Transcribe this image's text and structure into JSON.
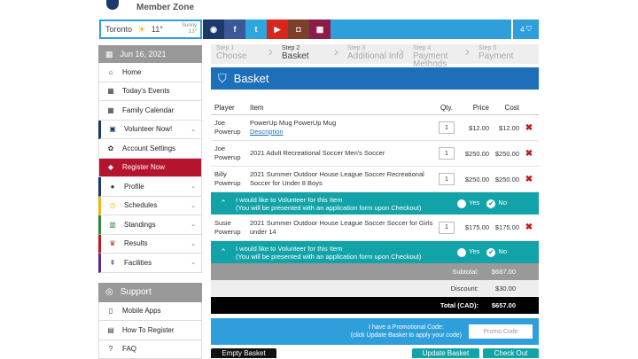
{
  "header": {
    "zone_title": "Member Zone",
    "cart_count": "4"
  },
  "weather": {
    "city": "Toronto",
    "temp": "11°",
    "condition": "Sunny",
    "condition_temp": "13°"
  },
  "sidebar": {
    "date": "Jun 16, 2021",
    "items": [
      {
        "label": "Home",
        "icon": "home-icon",
        "glyph": "⌂"
      },
      {
        "label": "Today's Events",
        "icon": "calendar-icon",
        "glyph": "▦"
      },
      {
        "label": "Family Calendar",
        "icon": "calendar-icon",
        "glyph": "▦"
      },
      {
        "label": "Volunteer Now!",
        "icon": "volunteer-icon",
        "glyph": "▣",
        "color": "#1b3a6b"
      },
      {
        "label": "Account Settings",
        "icon": "gear-icon",
        "glyph": "✿"
      },
      {
        "label": "Register Now",
        "icon": "tag-icon",
        "glyph": "◆"
      },
      {
        "label": "Profile",
        "icon": "user-icon",
        "glyph": "●",
        "color": "#1b3a6b"
      },
      {
        "label": "Schedules",
        "icon": "clock-icon",
        "glyph": "◷",
        "color": "#f3b21b"
      },
      {
        "label": "Standings",
        "icon": "bar-chart-icon",
        "glyph": "▥",
        "color": "#2e8b3a"
      },
      {
        "label": "Results",
        "icon": "trophy-icon",
        "glyph": "♛",
        "color": "#c01a1a"
      },
      {
        "label": "Facilities",
        "icon": "facilities-icon",
        "glyph": "⇞",
        "color": "#5a2d8c"
      }
    ],
    "support_title": "Support",
    "support_items": [
      {
        "label": "Mobile Apps",
        "icon": "mobile-icon",
        "glyph": "▯"
      },
      {
        "label": "How To Register",
        "icon": "document-icon",
        "glyph": "▤"
      },
      {
        "label": "FAQ",
        "icon": "question-icon",
        "glyph": "?"
      }
    ]
  },
  "steps": [
    {
      "num": "Step 1",
      "label": "Choose"
    },
    {
      "num": "Step 2",
      "label": "Basket"
    },
    {
      "num": "Step 3",
      "label": "Additional Info"
    },
    {
      "num": "Step 4",
      "label": "Payment Methods"
    },
    {
      "num": "Step 5",
      "label": "Payment"
    }
  ],
  "basket": {
    "title": "Basket",
    "columns": [
      "Player",
      "Item",
      "Qty.",
      "Price",
      "Cost"
    ],
    "rows": [
      {
        "player": "Joe Powerup",
        "item": "PowerUp Mug PowerUp Mug",
        "link": "Description",
        "qty": "1",
        "price": "$12.00",
        "cost": "$12.00"
      },
      {
        "player": "Joe Powerup",
        "item": "2021 Adult Recreational Soccer Men's Soccer",
        "qty": "1",
        "price": "$250.00",
        "cost": "$250.00"
      },
      {
        "player": "Billy Powerup",
        "item": "2021 Summer Outdoor House League Soccer Recreational Soccer for Under 8 Boys",
        "qty": "1",
        "price": "$250.00",
        "cost": "$250.00"
      },
      {
        "player": "Susie Powerup",
        "item": "2021 Summer Outdoor House League Soccer Soccer for Girls under 14",
        "qty": "1",
        "price": "$175.00",
        "cost": "$175.00"
      }
    ],
    "volunteer_text_1": "I would like to Volunteer for this Item",
    "volunteer_text_2": "(You will be presented with an application form upon Checkout)",
    "yes": "Yes",
    "no": "No",
    "subtotal_label": "Subtotal:",
    "subtotal": "$687.00",
    "discount_label": "Discount:",
    "discount": "$30.00",
    "total_label": "Total (CAD):",
    "total": "$657.00"
  },
  "promo": {
    "line1": "I have a Promotional Code:",
    "line2": "(click Update Basket to apply your code)",
    "placeholder": "Promo Code"
  },
  "buttons": {
    "empty": "Empty Basket",
    "update": "Update Basket",
    "checkout": "Check Out"
  },
  "colors": {
    "accent": "#2f9fdc",
    "brand": "#1e6fba",
    "register": "#b5142f",
    "volunteer": "#12a3a8"
  }
}
